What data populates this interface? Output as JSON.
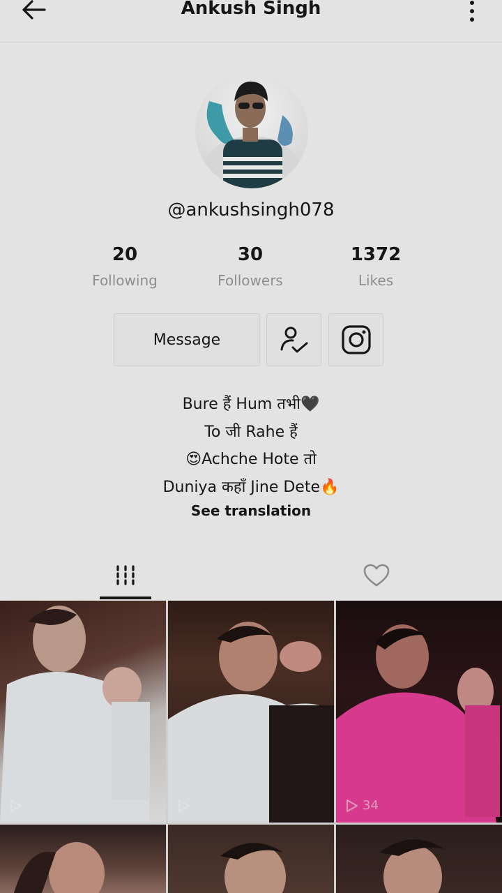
{
  "header": {
    "title": "Ankush Singh"
  },
  "profile": {
    "handle": "@ankushsingh078"
  },
  "stats": [
    {
      "value": "20",
      "label": "Following"
    },
    {
      "value": "30",
      "label": "Followers"
    },
    {
      "value": "1372",
      "label": "Likes"
    }
  ],
  "actions": {
    "message_label": "Message",
    "follow_icon": "person-check-icon",
    "instagram_icon": "instagram-icon"
  },
  "bio": {
    "lines": [
      "Bure हैं Hum तभी🖤",
      "To जी Rahe हैं",
      "😍Achche Hote तो",
      "Duniya कहाँ Jine Dete🔥"
    ],
    "translate_label": "See translation"
  },
  "tabs": [
    {
      "icon": "grid-icon",
      "active": true
    },
    {
      "icon": "heart-icon",
      "active": false
    }
  ],
  "videos": [
    {
      "views": "",
      "tone": "light"
    },
    {
      "views": "",
      "tone": "light"
    },
    {
      "views": "34",
      "tone": "pink"
    },
    {
      "views": "",
      "tone": "dark"
    },
    {
      "views": "",
      "tone": "dark"
    },
    {
      "views": "",
      "tone": "dark"
    }
  ]
}
